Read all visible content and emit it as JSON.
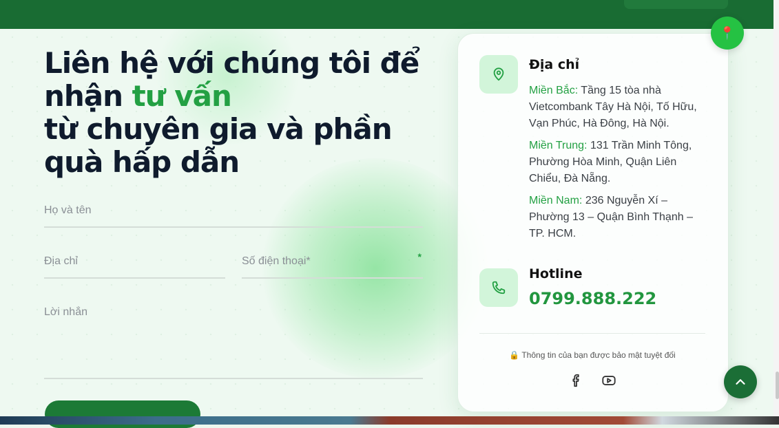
{
  "form": {
    "title_line1": "Liên hệ với chúng tôi để",
    "title_line2_prefix": "nhận",
    "title_accent": "tư vấn",
    "title_line3": "từ chuyên gia và phần",
    "title_line4": "quà hấp dẫn",
    "fullname_placeholder": "Họ và tên",
    "address_placeholder": "Địa chỉ",
    "phone_placeholder": "Số điện thoại*",
    "phone_required_mark": "*",
    "message_placeholder": "Lời nhắn"
  },
  "contact_card": {
    "address_heading": "Địa chỉ",
    "regions": [
      {
        "label": "Miền Bắc:",
        "text": "Tầng 15 tòa nhà Vietcombank Tây Hà Nội, Tố Hữu, Vạn Phúc, Hà Đông, Hà Nội."
      },
      {
        "label": "Miền Trung:",
        "text": "131 Trần Minh Tông, Phường Hòa Minh, Quận Liên Chiểu, Đà Nẵng."
      },
      {
        "label": "Miền Nam:",
        "text": "236 Nguyễn Xí – Phường 13 – Quận Bình Thạnh – TP. HCM."
      }
    ],
    "hotline_heading": "Hotline",
    "hotline_number": "0799.888.222",
    "secure_icon": "🔒",
    "secure_text": "Thông tin của bạn được bảo mật tuyệt đối",
    "socials": [
      "facebook-icon",
      "youtube-icon"
    ]
  },
  "floating": {
    "pin_icon": "📍",
    "scroll_top_icon": "chevron-up-icon"
  },
  "colors": {
    "brand_dark": "#196c33",
    "accent": "#23a043",
    "title": "#0f1b2d"
  }
}
